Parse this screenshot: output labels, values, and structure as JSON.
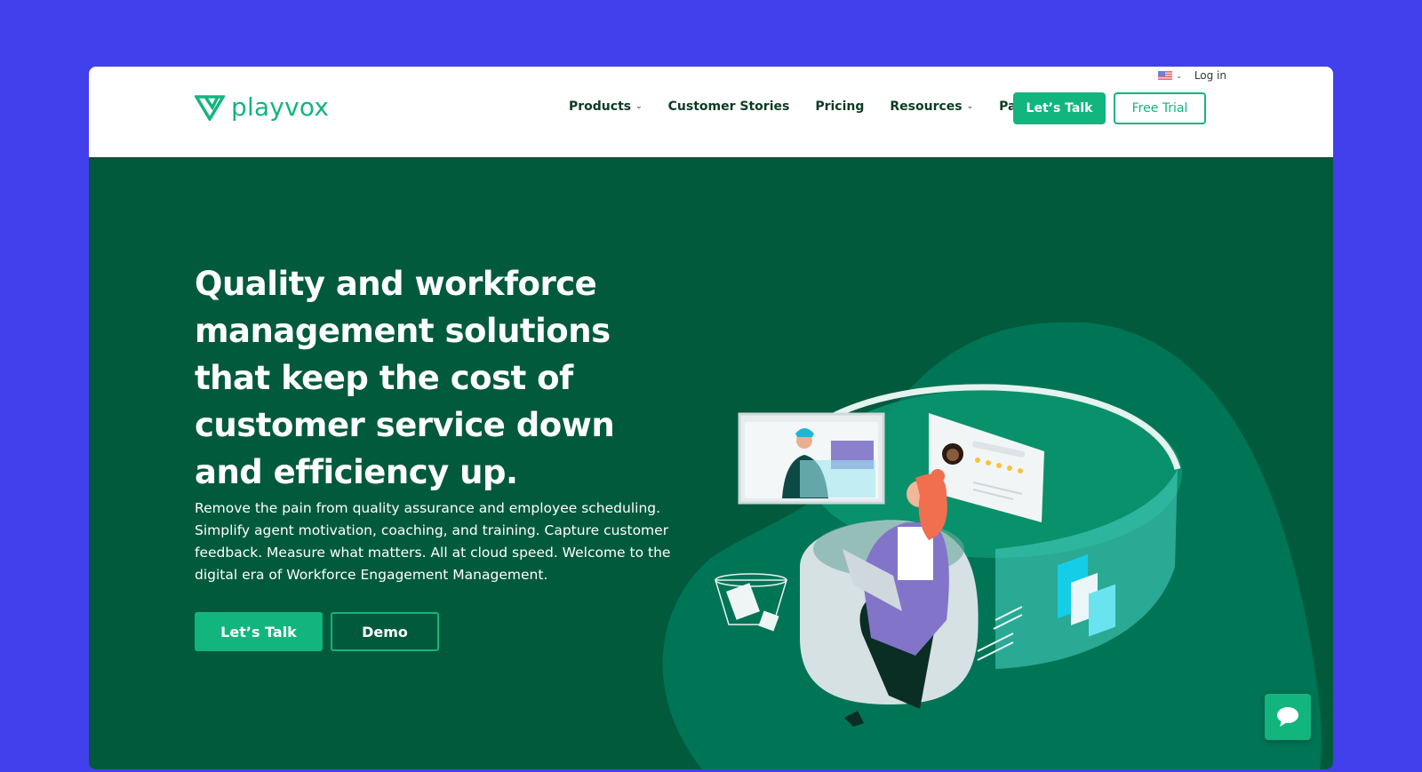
{
  "brand": {
    "name": "playvox",
    "logo_icon": "playvox-v-logo-icon",
    "accent_color": "#12b57e",
    "hero_bg_color": "#025a3c",
    "page_bg_color": "#423fec"
  },
  "topbar": {
    "language_icon": "us-flag-icon",
    "login_label": "Log in"
  },
  "nav": {
    "items": [
      {
        "label": "Products",
        "has_dropdown": true
      },
      {
        "label": "Customer Stories",
        "has_dropdown": false
      },
      {
        "label": "Pricing",
        "has_dropdown": false
      },
      {
        "label": "Resources",
        "has_dropdown": true
      },
      {
        "label": "Partners",
        "has_dropdown": false
      }
    ],
    "chevron": "⌄",
    "cta_primary": "Let’s Talk",
    "cta_secondary": "Free Trial"
  },
  "hero": {
    "headline": "Quality and workforce management solutions that keep the cost of customer service down and efficiency up.",
    "subtext": "Remove the pain from quality assurance and employee scheduling. Simplify agent motivation, coaching, and training. Capture customer feedback. Measure what matters. All at cloud speed. Welcome to the digital era of Workforce Engagement Management.",
    "cta_primary": "Let’s Talk",
    "cta_secondary": "Demo",
    "illustration": "woman-with-laptop-in-virtual-workspace-illustration",
    "rating_stars": 5
  },
  "chat_widget": {
    "icon": "chat-bubble-icon"
  }
}
